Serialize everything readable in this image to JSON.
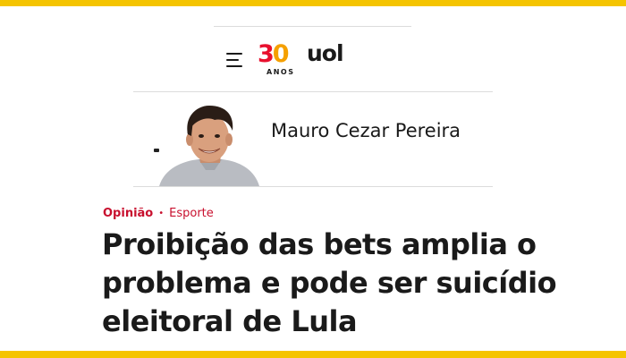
{
  "header": {
    "menu_icon": "hamburger-menu-icon",
    "logo": {
      "number_first": "3",
      "number_second": "0",
      "years_label": "ANOS",
      "brand": "uol"
    },
    "accent_color": "#f5c400"
  },
  "author": {
    "name": "Mauro Cezar Pereira",
    "avatar_icon": "author-photo"
  },
  "article": {
    "section": "Opinião",
    "separator": "•",
    "category": "Esporte",
    "title": "Proibição das bets amplia o problema e pode ser suicídio eleitoral de Lula",
    "category_color": "#c8102e"
  }
}
